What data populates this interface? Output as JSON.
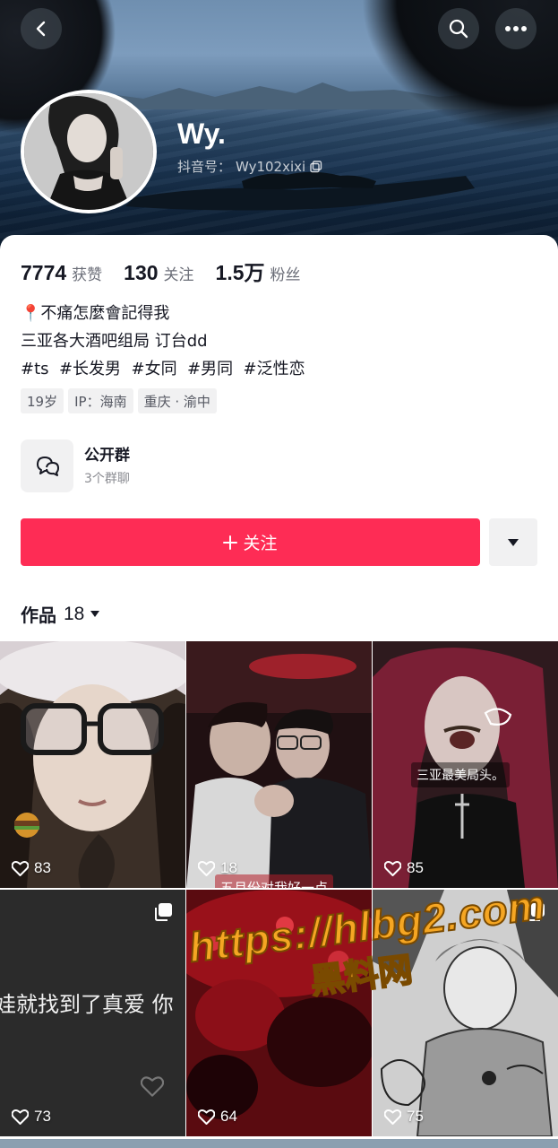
{
  "profile": {
    "nickname": "Wy.",
    "douyin_id_label": "抖音号：",
    "douyin_id": "Wy102xixi",
    "stats": [
      {
        "value": "7774",
        "label": "获赞"
      },
      {
        "value": "130",
        "label": "关注"
      },
      {
        "value": "1.5万",
        "label": "粉丝"
      }
    ],
    "bio_lines": [
      "📍不痛怎麼會記得我",
      "三亚各大酒吧组局 订台dd",
      "#ts  #长发男  #女同  #男同  #泛性恋"
    ],
    "tags": [
      "19岁",
      "IP：海南",
      "重庆 · 渝中"
    ]
  },
  "group": {
    "title": "公开群",
    "subtitle": "3个群聊"
  },
  "actions": {
    "follow_label": "关注"
  },
  "works": {
    "label": "作品",
    "count": "18"
  },
  "posts": [
    {
      "likes": "83",
      "overlay": ""
    },
    {
      "likes": "18",
      "overlay": "五月份对我好一点"
    },
    {
      "likes": "85",
      "overlay": "三亚最美局头。"
    },
    {
      "likes": "73",
      "overlay": "娃就找到了真爱 你"
    },
    {
      "likes": "64",
      "overlay": ""
    },
    {
      "likes": "75",
      "overlay": ""
    }
  ],
  "watermark": {
    "url": "https://hlbg2.com",
    "name": "黑料网"
  },
  "colors": {
    "accent": "#fe2c55",
    "text_primary": "#161823",
    "text_secondary": "#6b6e78"
  }
}
